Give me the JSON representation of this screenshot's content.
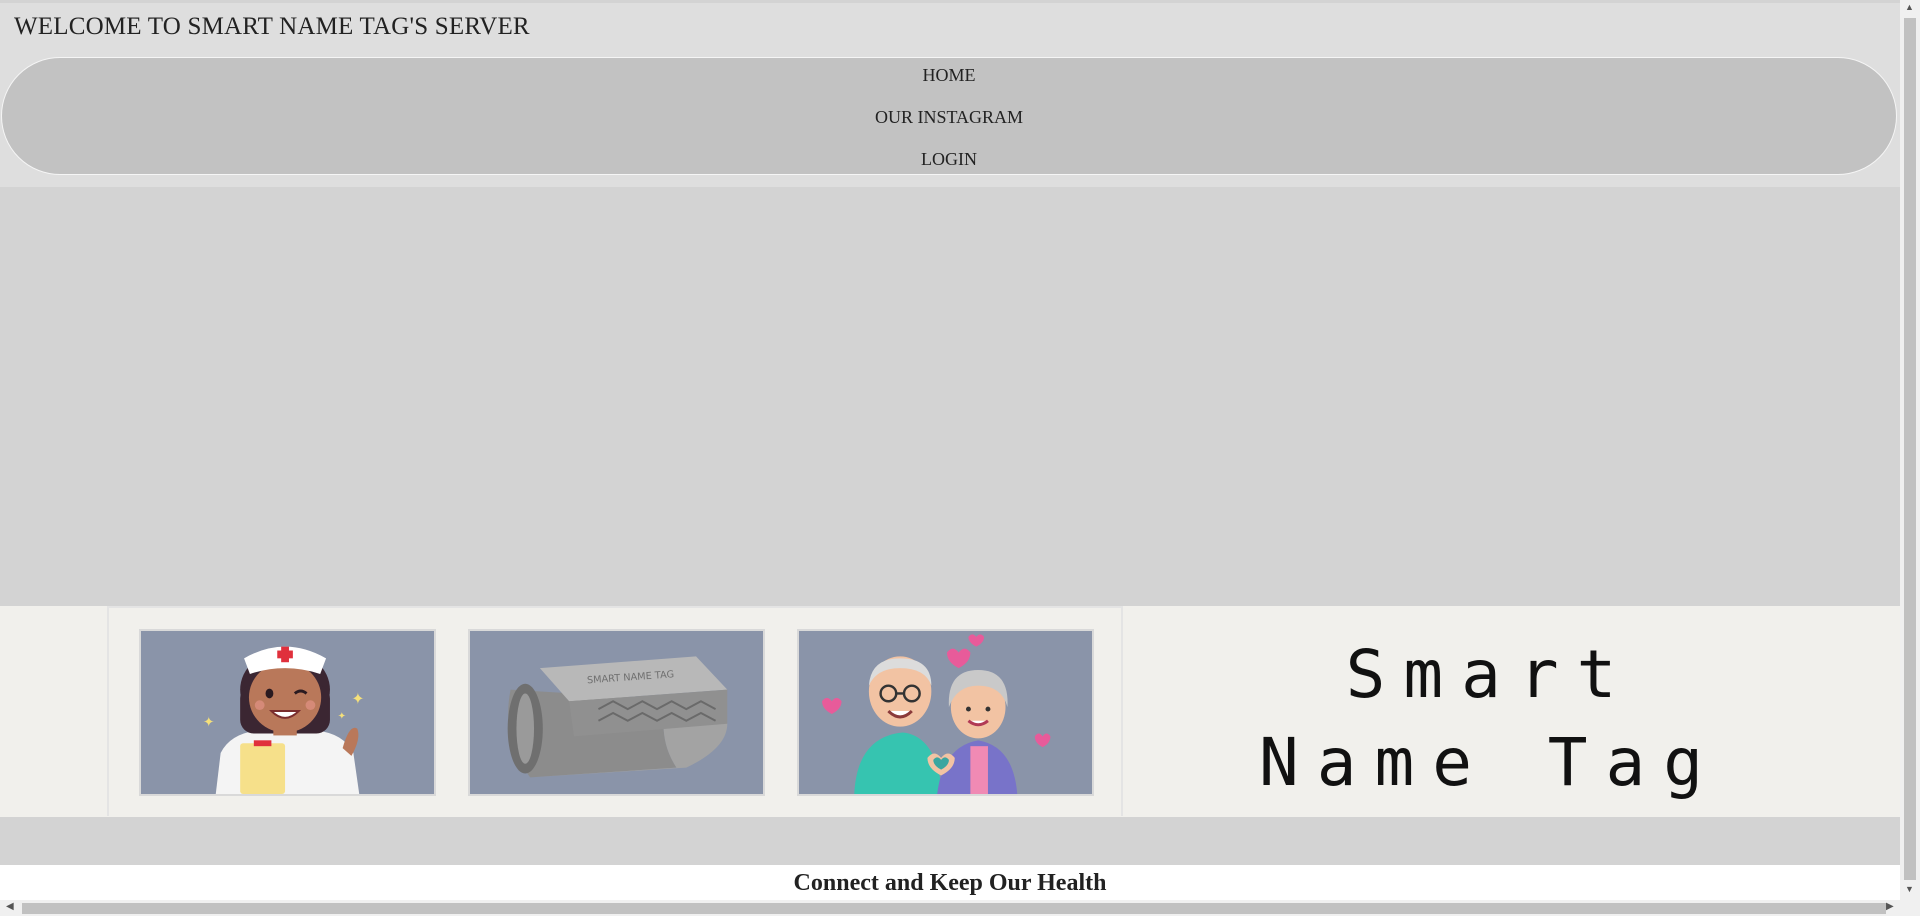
{
  "header": {
    "title": "WELCOME TO SMART NAME TAG'S SERVER"
  },
  "nav": {
    "items": [
      {
        "label": "HOME"
      },
      {
        "label": "OUR INSTAGRAM"
      },
      {
        "label": "LOGIN"
      }
    ]
  },
  "banner": {
    "images": [
      {
        "icon": "nurse-illustration"
      },
      {
        "icon": "smart-name-tag-device-render",
        "engraving": "SMART NAME TAG"
      },
      {
        "icon": "elderly-couple-illustration"
      }
    ],
    "brand_line1": "Smart",
    "brand_line2": "Name Tag"
  },
  "footer": {
    "tagline": "Connect and Keep Our Health"
  },
  "colors": {
    "nav_bg": "#c2c2c2",
    "page_bg": "#d3d3d3",
    "banner_bg": "#f1f0ec",
    "photo_bg": "#8a94a9"
  }
}
